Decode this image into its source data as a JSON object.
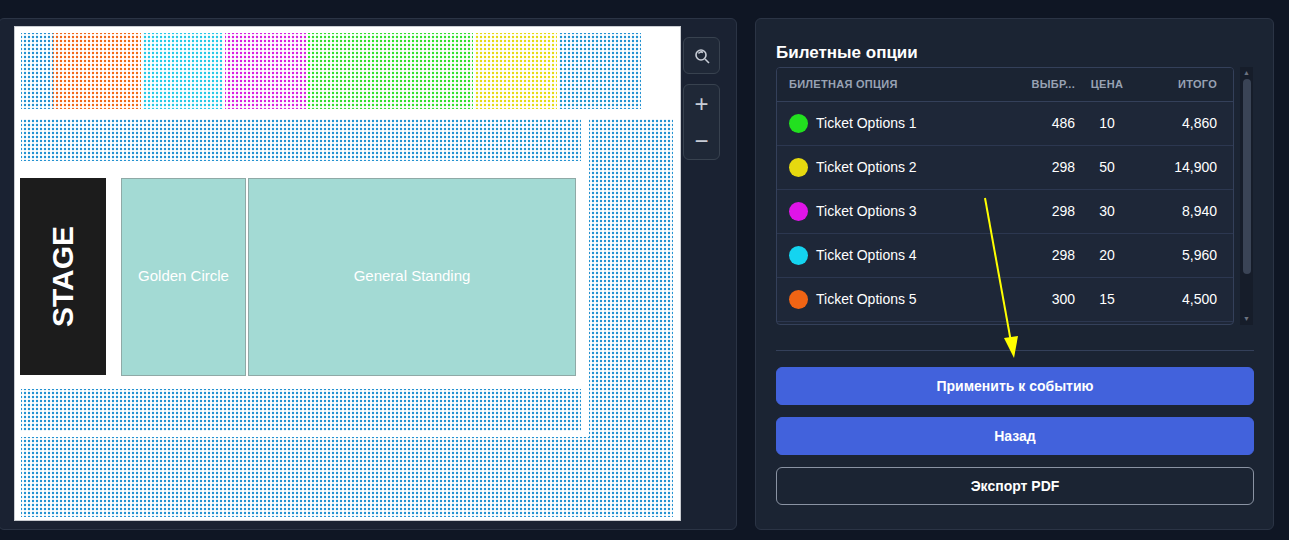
{
  "map": {
    "stage": "STAGE",
    "zones": [
      {
        "label": "Golden Circle"
      },
      {
        "label": "General Standing"
      }
    ],
    "seat_blocks": [
      {
        "color": "#1e8fd0"
      },
      {
        "color": "#f06414"
      },
      {
        "color": "#22c8e6"
      },
      {
        "color": "#d81ae0"
      },
      {
        "color": "#2ee02a"
      },
      {
        "color": "#e6d90f"
      },
      {
        "color": "#1e8fd0"
      },
      {
        "color": "#1e8fd0"
      },
      {
        "color": "#1e8fd0"
      },
      {
        "color": "#1e8fd0"
      },
      {
        "color": "#1e8fd0"
      }
    ]
  },
  "zoom": {
    "in": "+",
    "out": "−"
  },
  "panel": {
    "title": "Билетные опции",
    "columns": [
      "БИЛЕТНАЯ ОПЦИЯ",
      "ВЫБР...",
      "ЦЕНА",
      "ИТОГО"
    ],
    "rows": [
      {
        "name": "Ticket Options 1",
        "selected_count": "486",
        "price": "10",
        "total": "4,860",
        "color": "#22e01f"
      },
      {
        "name": "Ticket Options 2",
        "selected_count": "298",
        "price": "50",
        "total": "14,900",
        "color": "#e6d90f"
      },
      {
        "name": "Ticket Options 3",
        "selected_count": "298",
        "price": "30",
        "total": "8,940",
        "color": "#e014e8"
      },
      {
        "name": "Ticket Options 4",
        "selected_count": "298",
        "price": "20",
        "total": "5,960",
        "color": "#14d4f0"
      },
      {
        "name": "Ticket Options 5",
        "selected_count": "300",
        "price": "15",
        "total": "4,500",
        "color": "#f06414"
      }
    ],
    "buttons": [
      {
        "label": "Применить к событию",
        "kind": "primary"
      },
      {
        "label": "Назад",
        "kind": "primary"
      },
      {
        "label": "Экспорт PDF",
        "kind": "outline"
      }
    ]
  }
}
